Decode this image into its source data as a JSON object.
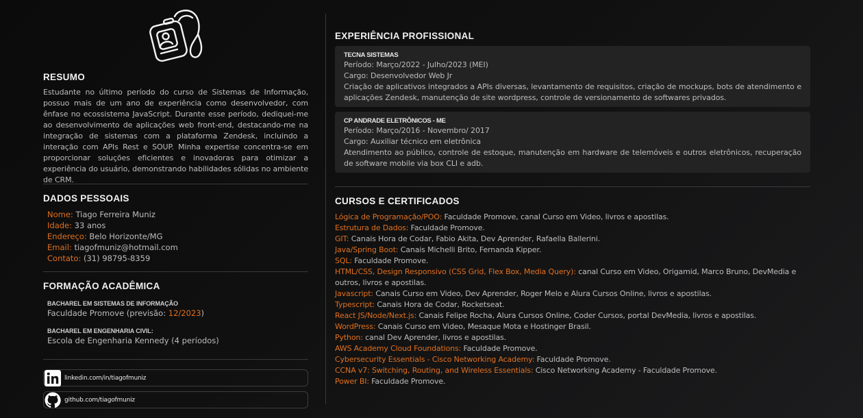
{
  "resumo": {
    "title": "RESUMO",
    "text": "Estudante no último período do curso de Sistemas de Informação, possuo mais de um ano de experiência como desenvolvedor, com ênfase no ecossistema JavaScript. Durante esse período, dediquei-me ao desenvolvimento de aplicações web front-end, destacando-me na integração de sistemas com a plataforma Zendesk, incluindo a interação com APIs Rest e SOUP. Minha expertise concentra-se em proporcionar soluções eficientes e inovadoras para otimizar a experiência do usuário, demonstrando habilidades sólidas no ambiente de CRM."
  },
  "dados": {
    "title": "DADOS PESSOAIS",
    "rows": [
      {
        "label": "Nome:",
        "value": "Tiago Ferreira Muniz"
      },
      {
        "label": "Idade:",
        "value": "33 anos"
      },
      {
        "label": "Endereço:",
        "value": "Belo Horizonte/MG"
      },
      {
        "label": "Email:",
        "value": "tiagofmuniz@hotmail.com"
      },
      {
        "label": "Contato:",
        "value": "(31) 98795-8359"
      }
    ]
  },
  "formacao": {
    "title": "FORMAÇÃO ACADÊMICA",
    "items": [
      {
        "title": "BACHAREL EM SISTEMAS DE INFORMAÇÃO",
        "prefix": "Faculdade Promove (previsão:",
        "highlight": "12/2023",
        "suffix": ")"
      },
      {
        "title": "BACHAREL EM ENGENHARIA CIVIL:",
        "prefix": "Escola de Engenharia Kennedy (4 períodos)",
        "highlight": "",
        "suffix": ""
      }
    ]
  },
  "links": {
    "linkedin": "linkedin.com/in/tiagofmuniz",
    "github": "github.com/tiagofmuniz"
  },
  "experiencia": {
    "title": "EXPERIÊNCIA PROFISSIONAL",
    "jobs": [
      {
        "company": "TECNA SISTEMAS",
        "period": "Período: Março/2022 - Julho/2023 (MEI)",
        "role": "Cargo: Desenvolvedor Web Jr",
        "desc": "Criação de aplicativos integrados a APIs diversas, levantamento de requisitos, criação de mockups, bots de atendimento e aplicações Zendesk, manutenção de site wordpress, controle de versionamento de softwares privados."
      },
      {
        "company": "CP ANDRADE ELETRÔNICOS - ME",
        "period": "Período: Março/2016 - Novembro/ 2017",
        "role": "Cargo: Auxiliar técnico em eletrônica",
        "desc": "Atendimento ao público, controle de estoque, manutenção em hardware de telemóveis e outros eletrônicos, recuperação de software mobile via box CLI e adb."
      }
    ]
  },
  "cursos": {
    "title": "CURSOS E CERTIFICADOS",
    "items": [
      {
        "name": "Lógica de Programação/POO:",
        "desc": "Faculdade Promove, canal Curso em Video, livros e apostilas."
      },
      {
        "name": "Estrutura de Dados:",
        "desc": "Faculdade Promove."
      },
      {
        "name": "GIT:",
        "desc": "Canais Hora de Codar, Fabio Akita, Dev Aprender, Rafaella Ballerini."
      },
      {
        "name": "Java/Spring Boot:",
        "desc": "Canais Michelli Brito, Fernanda Kipper."
      },
      {
        "name": "SQL:",
        "desc": "Faculdade Promove."
      },
      {
        "name": "HTML/CSS, Design Responsivo (CSS Grid, Flex Box, Media Query):",
        "desc": "canal Curso em Video, Origamid, Marco Bruno, DevMedia e outros, livros e apostilas."
      },
      {
        "name": "Javascript:",
        "desc": "Canais Curso em Video, Dev Aprender, Roger Melo e Alura Cursos Online, livros e apostilas."
      },
      {
        "name": "Typescript:",
        "desc": "Canais Hora de Codar, Rocketseat."
      },
      {
        "name": "React JS/Node/Next.js:",
        "desc": "Canais Felipe Rocha, Alura Cursos Online, Coder Cursos, portal DevMedia, livros e apostilas."
      },
      {
        "name": "WordPress:",
        "desc": "Canais Curso em Video, Mesaque Mota e Hostinger Brasil."
      },
      {
        "name": "Python:",
        "desc": "canal Dev Aprender, livros e apostilas."
      },
      {
        "name": "AWS Academy Cloud Foundations:",
        "desc": "Faculdade Promove."
      },
      {
        "name": "Cybersecurity Essentials - Cisco Networking Academy:",
        "desc": "Faculdade Promove."
      },
      {
        "name": "CCNA v7: Switching, Routing, and Wireless Essentials:",
        "desc": "Cisco Networking Academy - Faculdade Promove."
      },
      {
        "name": "Power BI:",
        "desc": "Faculdade Promove."
      }
    ]
  },
  "colors": {
    "accent": "#e0701f",
    "text": "#bdbdbd",
    "heading": "#f2f2f2",
    "card": "#232323"
  }
}
